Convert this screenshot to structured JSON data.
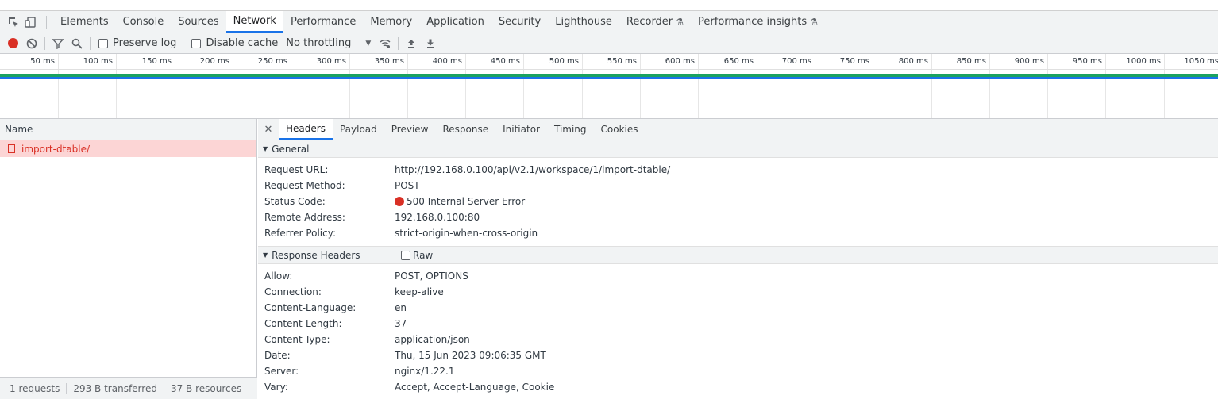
{
  "tabbar": {
    "tabs": [
      {
        "label": "Elements",
        "active": false
      },
      {
        "label": "Console",
        "active": false
      },
      {
        "label": "Sources",
        "active": false
      },
      {
        "label": "Network",
        "active": true
      },
      {
        "label": "Performance",
        "active": false
      },
      {
        "label": "Memory",
        "active": false
      },
      {
        "label": "Application",
        "active": false
      },
      {
        "label": "Security",
        "active": false
      },
      {
        "label": "Lighthouse",
        "active": false
      },
      {
        "label": "Recorder",
        "active": false,
        "experimental": true
      },
      {
        "label": "Performance insights",
        "active": false,
        "experimental": true
      }
    ]
  },
  "toolbar": {
    "preserve_log": "Preserve log",
    "disable_cache": "Disable cache",
    "throttling": "No throttling"
  },
  "timeline": {
    "ticks": [
      "50 ms",
      "100 ms",
      "150 ms",
      "200 ms",
      "250 ms",
      "300 ms",
      "350 ms",
      "400 ms",
      "450 ms",
      "500 ms",
      "550 ms",
      "600 ms",
      "650 ms",
      "700 ms",
      "750 ms",
      "800 ms",
      "850 ms",
      "900 ms",
      "950 ms",
      "1000 ms",
      "1050 ms"
    ]
  },
  "requests": {
    "header": "Name",
    "items": [
      {
        "name": "import-dtable/"
      }
    ],
    "status": {
      "requests": "1 requests",
      "transferred": "293 B transferred",
      "resources": "37 B resources"
    }
  },
  "details": {
    "tabs": [
      {
        "label": "Headers",
        "active": true
      },
      {
        "label": "Payload",
        "active": false
      },
      {
        "label": "Preview",
        "active": false
      },
      {
        "label": "Response",
        "active": false
      },
      {
        "label": "Initiator",
        "active": false
      },
      {
        "label": "Timing",
        "active": false
      },
      {
        "label": "Cookies",
        "active": false
      }
    ],
    "general": {
      "title": "General",
      "rows": [
        {
          "k": "Request URL:",
          "v": "http://192.168.0.100/api/v2.1/workspace/1/import-dtable/"
        },
        {
          "k": "Request Method:",
          "v": "POST"
        },
        {
          "k": "Status Code:",
          "v": "500 Internal Server Error",
          "status": "error"
        },
        {
          "k": "Remote Address:",
          "v": "192.168.0.100:80"
        },
        {
          "k": "Referrer Policy:",
          "v": "strict-origin-when-cross-origin"
        }
      ]
    },
    "response_headers": {
      "title": "Response Headers",
      "raw_label": "Raw",
      "rows": [
        {
          "k": "Allow:",
          "v": "POST, OPTIONS"
        },
        {
          "k": "Connection:",
          "v": "keep-alive"
        },
        {
          "k": "Content-Language:",
          "v": "en"
        },
        {
          "k": "Content-Length:",
          "v": "37"
        },
        {
          "k": "Content-Type:",
          "v": "application/json"
        },
        {
          "k": "Date:",
          "v": "Thu, 15 Jun 2023 09:06:35 GMT"
        },
        {
          "k": "Server:",
          "v": "nginx/1.22.1"
        },
        {
          "k": "Vary:",
          "v": "Accept, Accept-Language, Cookie"
        }
      ]
    }
  },
  "colors": {
    "accent": "#1a73e8",
    "error": "#d93025",
    "error_row_bg": "#fcd5d5",
    "timeline_green": "#1aa260"
  }
}
